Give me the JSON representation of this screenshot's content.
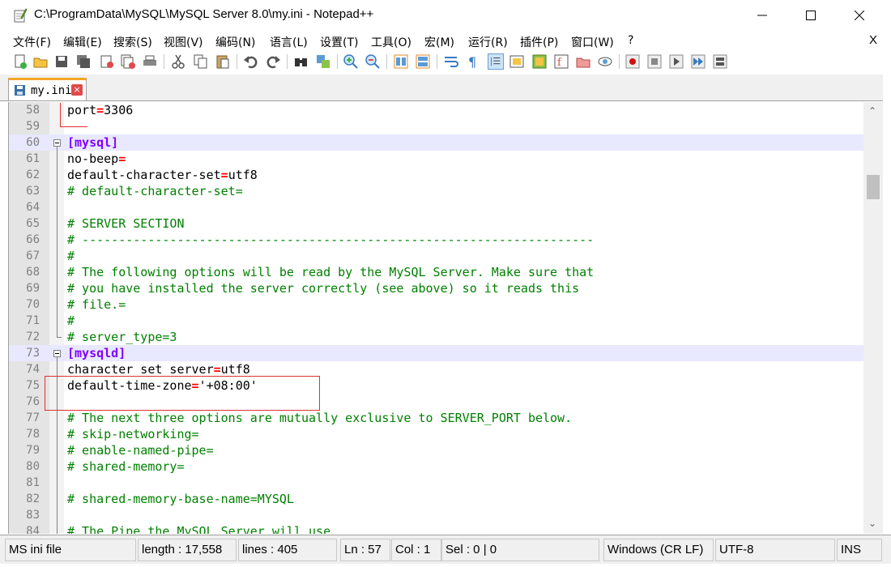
{
  "window": {
    "title": "C:\\ProgramData\\MySQL\\MySQL Server 8.0\\my.ini - Notepad++"
  },
  "menu": {
    "items": [
      "文件(F)",
      "编辑(E)",
      "搜索(S)",
      "视图(V)",
      "编码(N)",
      "语言(L)",
      "设置(T)",
      "工具(O)",
      "宏(M)",
      "运行(R)",
      "插件(P)",
      "窗口(W)",
      "?"
    ],
    "close": "X"
  },
  "tab": {
    "label": "my.ini",
    "close": "×"
  },
  "editor": {
    "lines": [
      {
        "num": "58",
        "text": "port=3306"
      },
      {
        "num": "59",
        "text": ""
      },
      {
        "num": "60",
        "text": "[mysql]"
      },
      {
        "num": "61",
        "text": "no-beep="
      },
      {
        "num": "62",
        "text": "default-character-set=utf8"
      },
      {
        "num": "63",
        "text": "# default-character-set="
      },
      {
        "num": "64",
        "text": ""
      },
      {
        "num": "65",
        "text": "# SERVER SECTION"
      },
      {
        "num": "66",
        "text": "# ----------------------------------------------------------------------"
      },
      {
        "num": "67",
        "text": "#"
      },
      {
        "num": "68",
        "text": "# The following options will be read by the MySQL Server. Make sure that"
      },
      {
        "num": "69",
        "text": "# you have installed the server correctly (see above) so it reads this"
      },
      {
        "num": "70",
        "text": "# file.="
      },
      {
        "num": "71",
        "text": "#"
      },
      {
        "num": "72",
        "text": "# server_type=3"
      },
      {
        "num": "73",
        "text": "[mysqld]"
      },
      {
        "num": "74",
        "text": "character_set_server=utf8"
      },
      {
        "num": "75",
        "text": "default-time-zone='+08:00'"
      },
      {
        "num": "76",
        "text": ""
      },
      {
        "num": "77",
        "text": "# The next three options are mutually exclusive to SERVER_PORT below."
      },
      {
        "num": "78",
        "text": "# skip-networking="
      },
      {
        "num": "79",
        "text": "# enable-named-pipe="
      },
      {
        "num": "80",
        "text": "# shared-memory="
      },
      {
        "num": "81",
        "text": ""
      },
      {
        "num": "82",
        "text": "# shared-memory-base-name=MYSQL"
      },
      {
        "num": "83",
        "text": ""
      },
      {
        "num": "84",
        "text": "# The Pipe the MySQL Server will use"
      }
    ]
  },
  "status": {
    "file_type": "MS ini file",
    "length": "length : 17,558",
    "lines": "lines : 405",
    "ln": "Ln : 57",
    "col": "Col : 1",
    "sel": "Sel : 0 | 0",
    "eol": "Windows (CR LF)",
    "encoding": "UTF-8",
    "mode": "INS"
  }
}
